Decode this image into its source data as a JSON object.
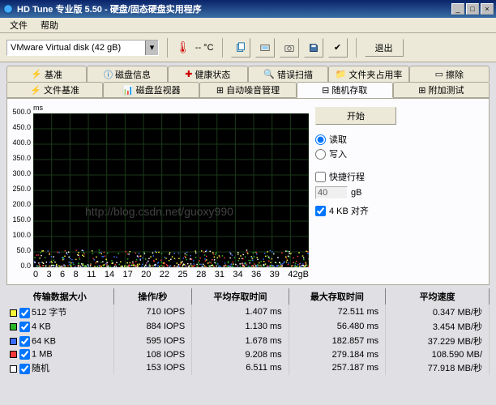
{
  "window": {
    "title": "HD Tune 专业版 5.50 - 硬盘/固态硬盘实用程序",
    "min": "_",
    "max": "□",
    "close": "×"
  },
  "menu": {
    "file": "文件",
    "help": "帮助"
  },
  "toolbar": {
    "disk": "VMware Virtual disk (42 gB)",
    "temp": "-- °C",
    "exit": "退出"
  },
  "tabs_top": {
    "benchmark": "基准",
    "diskinfo": "磁盘信息",
    "health": "健康状态",
    "errorscan": "错误扫描",
    "folderusage": "文件夹占用率",
    "erase": "擦除"
  },
  "tabs_low": {
    "filebench": "文件基准",
    "monitor": "磁盘监视器",
    "aam": "自动噪音管理",
    "random": "随机存取",
    "extra": "附加测试"
  },
  "side": {
    "start": "开始",
    "read": "读取",
    "write": "写入",
    "shortstroke": "快捷行程",
    "size_val": "40",
    "size_unit": "gB",
    "align": "4 KB 对齐"
  },
  "chart_data": {
    "type": "scatter",
    "ylabel_unit": "ms",
    "ylim": [
      0,
      500
    ],
    "yticks": [
      0,
      50,
      100,
      150,
      200,
      250,
      300,
      350,
      400,
      450,
      500
    ],
    "xlim": [
      0,
      42
    ],
    "xticks_labels": [
      "0",
      "3",
      "6",
      "8",
      "11",
      "14",
      "17",
      "20",
      "22",
      "25",
      "28",
      "31",
      "34",
      "36",
      "39",
      "42gB"
    ],
    "series": [
      {
        "name": "512 字节",
        "color": "#f5f53a"
      },
      {
        "name": "4 KB",
        "color": "#2ab82a"
      },
      {
        "name": "64 KB",
        "color": "#3a6cf5"
      },
      {
        "name": "1 MB",
        "color": "#f53a3a"
      },
      {
        "name": "随机",
        "color": "#ffffff"
      }
    ]
  },
  "table": {
    "headers": {
      "size": "传输数据大小",
      "ops": "操作/秒",
      "avg": "平均存取时间",
      "max": "最大存取时间",
      "speed": "平均速度"
    },
    "rows": [
      {
        "color": "#f5f53a",
        "name": "512 字节",
        "ops": "710 IOPS",
        "avg": "1.407 ms",
        "max": "72.511 ms",
        "speed": "0.347 MB/秒"
      },
      {
        "color": "#2ab82a",
        "name": "4 KB",
        "ops": "884 IOPS",
        "avg": "1.130 ms",
        "max": "56.480 ms",
        "speed": "3.454 MB/秒"
      },
      {
        "color": "#3a6cf5",
        "name": "64 KB",
        "ops": "595 IOPS",
        "avg": "1.678 ms",
        "max": "182.857 ms",
        "speed": "37.229 MB/秒"
      },
      {
        "color": "#f53a3a",
        "name": "1 MB",
        "ops": "108 IOPS",
        "avg": "9.208 ms",
        "max": "279.184 ms",
        "speed": "108.590 MB/"
      },
      {
        "color": "#ffffff",
        "name": "随机",
        "ops": "153 IOPS",
        "avg": "6.511 ms",
        "max": "257.187 ms",
        "speed": "77.918 MB/秒"
      }
    ]
  },
  "watermark": "http://blog.csdn.net/guoxy990"
}
